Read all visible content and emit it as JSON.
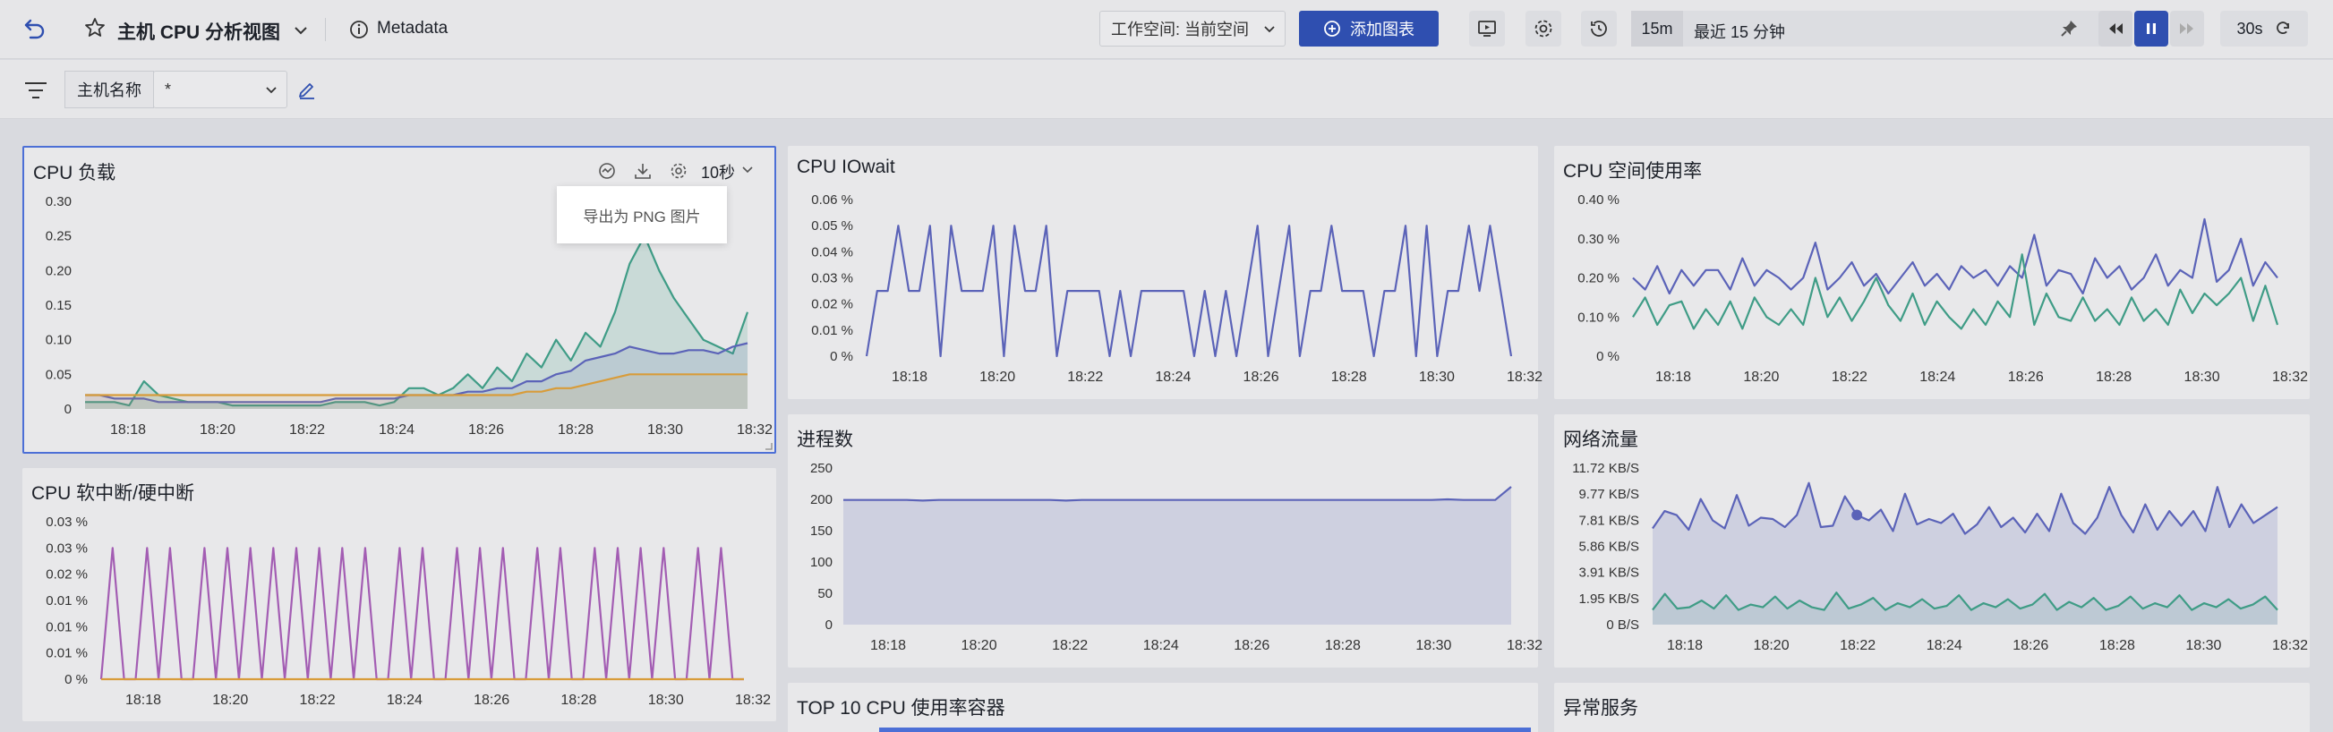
{
  "topbar": {
    "title": "主机 CPU 分析视图",
    "metadata_label": "Metadata",
    "workspace_label": "工作空间: 当前空间",
    "add_chart_label": "添加图表",
    "time_short": "15m",
    "time_long": "最近 15 分钟",
    "refresh_interval": "30s"
  },
  "filterbar": {
    "host_label": "主机名称",
    "host_value": "*"
  },
  "panels": {
    "cpu_load": {
      "title": "CPU 负载",
      "interval": "10秒",
      "tooltip": "导出为 PNG 图片",
      "yticks": [
        "0.30",
        "0.25",
        "0.20",
        "0.15",
        "0.10",
        "0.05",
        "0"
      ]
    },
    "iowait": {
      "title": "CPU IOwait",
      "yticks": [
        "0.06 %",
        "0.05 %",
        "0.04 %",
        "0.03 %",
        "0.02 %",
        "0.01 %",
        "0 %"
      ]
    },
    "space": {
      "title": "CPU 空间使用率",
      "yticks": [
        "0.40 %",
        "0.30 %",
        "0.20 %",
        "0.10 %",
        "0 %"
      ]
    },
    "softirq": {
      "title": "CPU 软中断/硬中断",
      "yticks": [
        "0.03 %",
        "0.03 %",
        "0.02 %",
        "0.01 %",
        "0.01 %",
        "0.01 %",
        "0 %"
      ]
    },
    "procs": {
      "title": "进程数",
      "yticks": [
        "250",
        "200",
        "150",
        "100",
        "50",
        "0"
      ]
    },
    "network": {
      "title": "网络流量",
      "yticks": [
        "11.72 KB/S",
        "9.77 KB/S",
        "7.81 KB/S",
        "5.86 KB/S",
        "3.91 KB/S",
        "1.95 KB/S",
        "0 B/S"
      ]
    },
    "top10": {
      "title": "TOP 10 CPU 使用率容器"
    },
    "abnormal": {
      "title": "异常服务"
    }
  },
  "xticks": [
    "18:18",
    "18:20",
    "18:22",
    "18:24",
    "18:26",
    "18:28",
    "18:30",
    "18:32"
  ],
  "colors": {
    "blue": "#5b63b8",
    "green": "#3f9c86",
    "orange": "#d89c3a",
    "purple": "#a35db3",
    "accent": "#2f4fb0"
  },
  "chart_data": [
    {
      "type": "line",
      "title": "CPU 负载",
      "ylim": [
        0,
        0.3
      ],
      "series": [
        {
          "values": [
            0.01,
            0.01,
            0.01,
            0.005,
            0.04,
            0.02,
            0.015,
            0.01,
            0.01,
            0.01,
            0.005,
            0.005,
            0.005,
            0.005,
            0.005,
            0.005,
            0.005,
            0.01,
            0.01,
            0.01,
            0.005,
            0.01,
            0.03,
            0.03,
            0.02,
            0.03,
            0.05,
            0.03,
            0.06,
            0.04,
            0.08,
            0.06,
            0.1,
            0.07,
            0.11,
            0.09,
            0.14,
            0.21,
            0.25,
            0.2,
            0.16,
            0.13,
            0.1,
            0.09,
            0.08,
            0.14
          ]
        },
        {
          "values": [
            0.02,
            0.02,
            0.015,
            0.015,
            0.015,
            0.01,
            0.01,
            0.01,
            0.01,
            0.01,
            0.01,
            0.01,
            0.01,
            0.01,
            0.01,
            0.01,
            0.01,
            0.015,
            0.015,
            0.015,
            0.015,
            0.015,
            0.02,
            0.02,
            0.02,
            0.02,
            0.025,
            0.025,
            0.03,
            0.03,
            0.04,
            0.04,
            0.05,
            0.055,
            0.07,
            0.075,
            0.08,
            0.09,
            0.085,
            0.08,
            0.08,
            0.085,
            0.085,
            0.08,
            0.09,
            0.095
          ]
        },
        {
          "values": [
            0.02,
            0.02,
            0.02,
            0.02,
            0.02,
            0.02,
            0.02,
            0.02,
            0.02,
            0.02,
            0.02,
            0.02,
            0.02,
            0.02,
            0.02,
            0.02,
            0.02,
            0.02,
            0.02,
            0.02,
            0.02,
            0.02,
            0.02,
            0.02,
            0.02,
            0.02,
            0.02,
            0.02,
            0.02,
            0.02,
            0.025,
            0.025,
            0.03,
            0.03,
            0.035,
            0.04,
            0.045,
            0.05,
            0.05,
            0.05,
            0.05,
            0.05,
            0.05,
            0.05,
            0.05,
            0.05
          ]
        }
      ]
    },
    {
      "type": "line",
      "title": "CPU IOwait",
      "ylim": [
        0,
        0.06
      ],
      "series": [
        {
          "values": [
            0.0,
            0.025,
            0.025,
            0.05,
            0.025,
            0.025,
            0.05,
            0.0,
            0.05,
            0.025,
            0.025,
            0.025,
            0.05,
            0.0,
            0.05,
            0.025,
            0.025,
            0.05,
            0.0,
            0.025,
            0.025,
            0.025,
            0.025,
            0.0,
            0.025,
            0.0,
            0.025,
            0.025,
            0.025,
            0.025,
            0.025,
            0.0,
            0.025,
            0.0,
            0.025,
            0.0,
            0.025,
            0.05,
            0.0,
            0.025,
            0.05,
            0.0,
            0.025,
            0.025,
            0.05,
            0.025,
            0.025,
            0.025,
            0.0,
            0.025,
            0.025,
            0.05,
            0.0,
            0.05,
            0.0,
            0.025,
            0.025,
            0.05,
            0.025,
            0.05,
            0.025,
            0.0
          ]
        }
      ]
    },
    {
      "type": "line",
      "title": "CPU 空间使用率",
      "ylim": [
        0,
        0.4
      ],
      "series": [
        {
          "values": [
            0.2,
            0.17,
            0.23,
            0.16,
            0.22,
            0.18,
            0.22,
            0.22,
            0.17,
            0.25,
            0.18,
            0.22,
            0.2,
            0.17,
            0.2,
            0.29,
            0.17,
            0.2,
            0.24,
            0.18,
            0.21,
            0.16,
            0.2,
            0.24,
            0.18,
            0.21,
            0.17,
            0.23,
            0.2,
            0.22,
            0.18,
            0.23,
            0.2,
            0.31,
            0.18,
            0.22,
            0.21,
            0.16,
            0.25,
            0.2,
            0.23,
            0.17,
            0.2,
            0.26,
            0.18,
            0.22,
            0.2,
            0.35,
            0.19,
            0.22,
            0.3,
            0.18,
            0.24,
            0.2
          ]
        },
        {
          "values": [
            0.1,
            0.15,
            0.08,
            0.13,
            0.14,
            0.07,
            0.12,
            0.08,
            0.14,
            0.07,
            0.15,
            0.1,
            0.08,
            0.12,
            0.08,
            0.2,
            0.1,
            0.15,
            0.09,
            0.14,
            0.2,
            0.13,
            0.09,
            0.16,
            0.08,
            0.14,
            0.1,
            0.07,
            0.12,
            0.08,
            0.14,
            0.1,
            0.26,
            0.08,
            0.16,
            0.1,
            0.09,
            0.15,
            0.09,
            0.12,
            0.08,
            0.15,
            0.09,
            0.12,
            0.08,
            0.17,
            0.11,
            0.16,
            0.13,
            0.16,
            0.2,
            0.09,
            0.18,
            0.08
          ]
        }
      ]
    },
    {
      "type": "line",
      "title": "CPU 软中断/硬中断",
      "ylim": [
        0,
        0.03
      ],
      "series": [
        {
          "values": [
            0,
            0.025,
            0,
            0,
            0.025,
            0,
            0.025,
            0,
            0,
            0.025,
            0,
            0.025,
            0,
            0.025,
            0,
            0.025,
            0,
            0.025,
            0,
            0.025,
            0,
            0.025,
            0,
            0.025,
            0,
            0,
            0.025,
            0,
            0.025,
            0,
            0,
            0.025,
            0,
            0.025,
            0,
            0.025,
            0,
            0,
            0.025,
            0,
            0.025,
            0,
            0,
            0.025,
            0,
            0.025,
            0,
            0.025,
            0,
            0.025,
            0,
            0,
            0.025,
            0,
            0.025,
            0,
            0
          ]
        },
        {
          "values": [
            0,
            0,
            0,
            0,
            0,
            0,
            0,
            0,
            0,
            0,
            0,
            0,
            0,
            0,
            0,
            0,
            0,
            0,
            0,
            0
          ]
        }
      ]
    },
    {
      "type": "area",
      "title": "进程数",
      "ylim": [
        0,
        250
      ],
      "series": [
        {
          "values": [
            199,
            199,
            199,
            199,
            199,
            198,
            199,
            199,
            199,
            199,
            199,
            199,
            199,
            199,
            198,
            199,
            199,
            199,
            199,
            199,
            199,
            199,
            199,
            199,
            199,
            199,
            199,
            199,
            199,
            199,
            199,
            199,
            199,
            199,
            199,
            199,
            199,
            199,
            200,
            199,
            199,
            199,
            220
          ]
        }
      ]
    },
    {
      "type": "line",
      "title": "网络流量",
      "ylim": [
        0,
        11.72
      ],
      "series": [
        {
          "values": [
            7.2,
            8.5,
            8.2,
            7.1,
            9.4,
            7.8,
            7.2,
            9.7,
            7.4,
            8.0,
            7.9,
            7.3,
            8.2,
            10.6,
            7.3,
            7.4,
            9.6,
            8.2,
            7.8,
            8.6,
            7.0,
            9.8,
            7.5,
            7.9,
            7.6,
            8.3,
            6.8,
            7.5,
            8.8,
            7.3,
            8.0,
            6.9,
            8.3,
            7.0,
            9.8,
            7.6,
            6.8,
            8.0,
            10.3,
            8.2,
            6.9,
            9.0,
            7.1,
            8.5,
            7.4,
            8.5,
            7.0,
            10.3,
            7.3,
            9.0,
            7.6,
            8.2,
            8.8
          ]
        },
        {
          "values": [
            1.1,
            2.3,
            1.2,
            1.3,
            1.8,
            1.2,
            2.2,
            1.1,
            1.5,
            1.3,
            2.1,
            1.2,
            1.8,
            1.3,
            1.1,
            2.4,
            1.2,
            1.5,
            2.0,
            1.1,
            1.6,
            1.3,
            1.9,
            1.2,
            1.4,
            2.2,
            1.1,
            1.6,
            1.3,
            1.9,
            1.2,
            1.5,
            2.3,
            1.1,
            1.7,
            1.3,
            2.0,
            1.1,
            1.4,
            2.1,
            1.2,
            1.6,
            1.3,
            2.2,
            1.1,
            1.6,
            1.3,
            1.9,
            1.2,
            1.5,
            2.1,
            1.1
          ]
        }
      ]
    }
  ]
}
